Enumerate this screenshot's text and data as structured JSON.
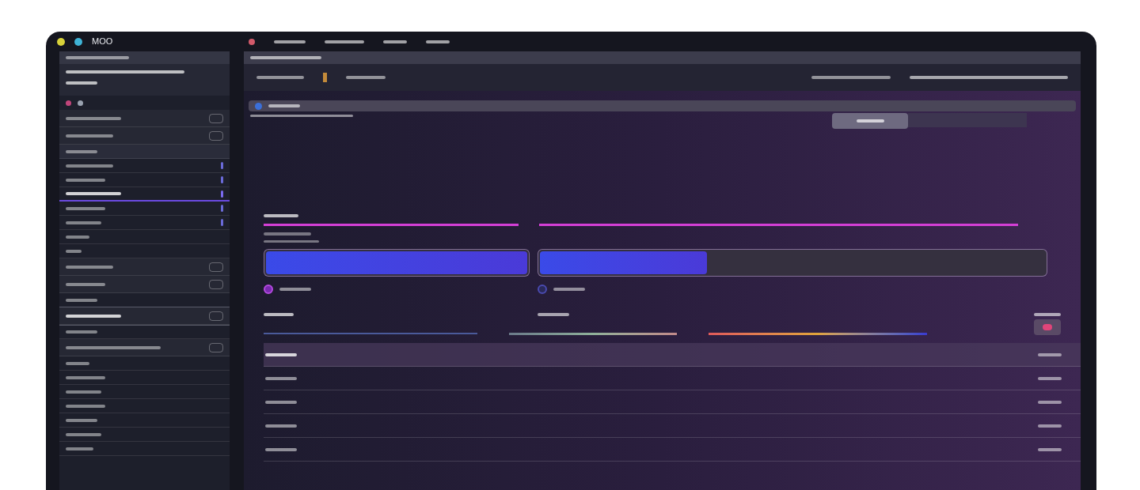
{
  "window": {
    "title": "MOO"
  },
  "sidebar": {
    "rows": [
      {
        "kind": "field",
        "selected": false
      },
      {
        "kind": "field",
        "selected": false
      },
      {
        "kind": "header",
        "selected": false
      },
      {
        "kind": "slider-row",
        "selected": false
      },
      {
        "kind": "slider-row",
        "selected": false
      },
      {
        "kind": "slider-row",
        "selected": true
      },
      {
        "kind": "slider-row",
        "selected": false
      },
      {
        "kind": "slider-row",
        "selected": false
      },
      {
        "kind": "row",
        "selected": false
      },
      {
        "kind": "row",
        "selected": false
      },
      {
        "kind": "field",
        "selected": false
      },
      {
        "kind": "field",
        "selected": false
      },
      {
        "kind": "row",
        "selected": false
      },
      {
        "kind": "field",
        "selected": true
      },
      {
        "kind": "row",
        "selected": false
      },
      {
        "kind": "field",
        "selected": false
      },
      {
        "kind": "row",
        "selected": false
      },
      {
        "kind": "row",
        "selected": false
      },
      {
        "kind": "row",
        "selected": false
      },
      {
        "kind": "row",
        "selected": false
      },
      {
        "kind": "row",
        "selected": false
      },
      {
        "kind": "row",
        "selected": false
      },
      {
        "kind": "row",
        "selected": false
      }
    ]
  },
  "main": {
    "progress_bars": [
      {
        "level": 1,
        "radio_selected": true
      },
      {
        "level": 0.33,
        "radio_selected": false
      }
    ],
    "list_rows": [
      {
        "selected": true
      },
      {
        "selected": false
      },
      {
        "selected": false
      },
      {
        "selected": false
      },
      {
        "selected": false
      }
    ]
  }
}
